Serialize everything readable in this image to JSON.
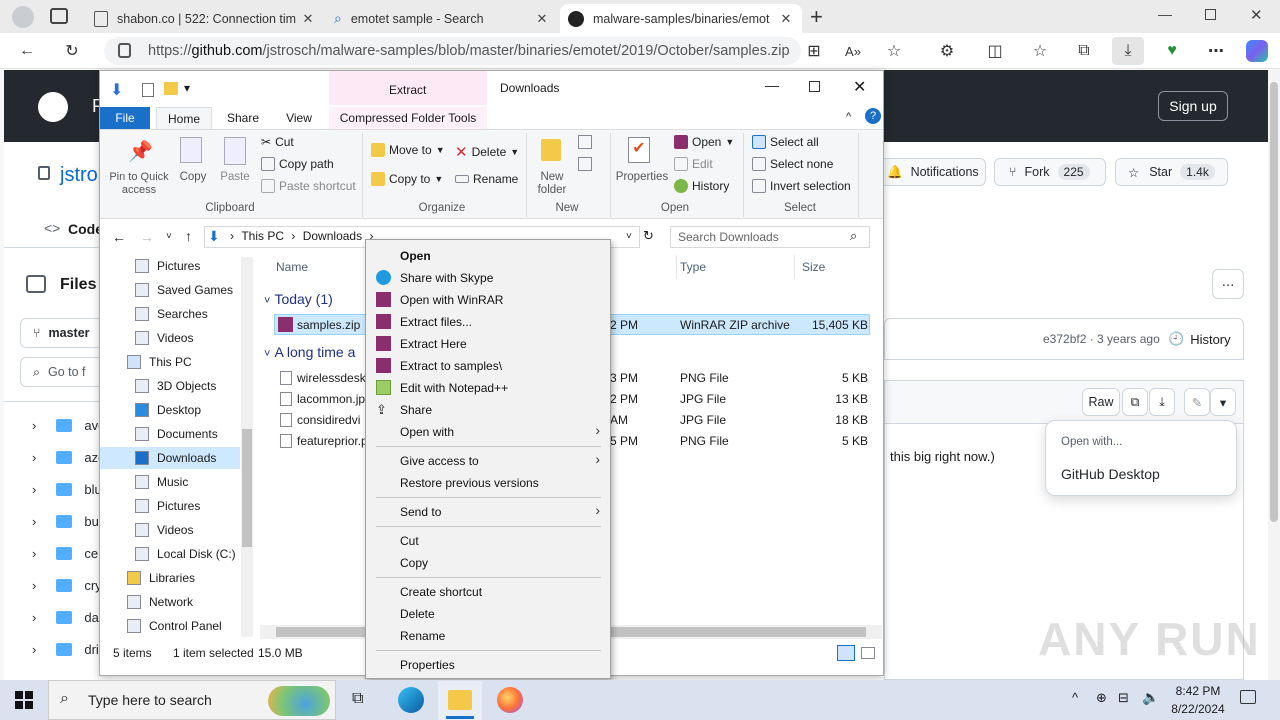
{
  "browser": {
    "tabs": [
      {
        "title": "shabon.co | 522: Connection tim",
        "active": false
      },
      {
        "title": "emotet sample - Search",
        "active": false
      },
      {
        "title": "malware-samples/binaries/emot",
        "active": true
      }
    ],
    "new_tab": "+",
    "url_prefix": "https://",
    "url_host": "github.com",
    "url_path": "/jstrosch/malware-samples/blob/master/binaries/emotet/2019/October/samples.zip"
  },
  "github": {
    "sign_up": "Sign up",
    "repo_owner": "jstro",
    "code_tab": "Code",
    "notifications": "Notifications",
    "fork_label": "Fork",
    "fork_count": "225",
    "star_label": "Star",
    "star_count": "1.4k",
    "files_title": "Files",
    "branch": "master",
    "goto_placeholder": "Go to f",
    "commit_info": "e372bf2 · 3 years ago",
    "history": "History",
    "raw": "Raw",
    "too_big": "this big right now.)",
    "tree": [
      "ave",
      "azo",
      "blue",
      "bue",
      "cerb",
      "cryp",
      "dan",
      "dric"
    ],
    "open_with": {
      "header": "Open with...",
      "item": "GitHub Desktop"
    },
    "header_extra_text": "o"
  },
  "explorer": {
    "title": "Downloads",
    "contextual_tab": "Extract",
    "ribbon_tabs": {
      "file": "File",
      "home": "Home",
      "share": "Share",
      "view": "View",
      "compressed": "Compressed Folder Tools"
    },
    "clipboard": {
      "pin": "Pin to Quick access",
      "copy": "Copy",
      "paste": "Paste",
      "cut": "Cut",
      "copy_path": "Copy path",
      "paste_shortcut": "Paste shortcut",
      "label": "Clipboard"
    },
    "organize": {
      "move_to": "Move to",
      "copy_to": "Copy to",
      "delete": "Delete",
      "rename": "Rename",
      "label": "Organize"
    },
    "new": {
      "new_folder": "New folder",
      "label": "New"
    },
    "open": {
      "properties": "Properties",
      "open": "Open",
      "edit": "Edit",
      "history": "History",
      "label": "Open"
    },
    "select": {
      "all": "Select all",
      "none": "Select none",
      "invert": "Invert selection",
      "label": "Select"
    },
    "breadcrumb": [
      "This PC",
      "Downloads"
    ],
    "search_placeholder": "Search Downloads",
    "nav_items": [
      "Pictures",
      "Saved Games",
      "Searches",
      "Videos",
      "This PC",
      "3D Objects",
      "Desktop",
      "Documents",
      "Downloads",
      "Music",
      "Pictures",
      "Videos",
      "Local Disk (C:)",
      "Libraries",
      "Network",
      "Control Panel"
    ],
    "columns": {
      "name": "Name",
      "type": "Type",
      "size": "Size"
    },
    "groups": {
      "today": "Today (1)",
      "long_ago": "A long time a"
    },
    "files": [
      {
        "name": "samples.zip",
        "time": "2 PM",
        "type": "WinRAR ZIP archive",
        "size": "15,405 KB"
      },
      {
        "name": "wirelessdeskt",
        "time": "3 PM",
        "type": "PNG File",
        "size": "5 KB"
      },
      {
        "name": "lacommon.jp",
        "time": "2 PM",
        "type": "JPG File",
        "size": "13 KB"
      },
      {
        "name": "considiredvi",
        "time": "AM",
        "type": "JPG File",
        "size": "18 KB"
      },
      {
        "name": "featureprior.p",
        "time": "5 PM",
        "type": "PNG File",
        "size": "5 KB"
      }
    ],
    "status": {
      "items": "5 items",
      "selected": "1 item selected",
      "size": "15.0 MB"
    }
  },
  "context_menu": {
    "open": "Open",
    "skype": "Share with Skype",
    "winrar": "Open with WinRAR",
    "extract_files": "Extract files...",
    "extract_here": "Extract Here",
    "extract_to": "Extract to samples\\",
    "notepad": "Edit with Notepad++",
    "share": "Share",
    "open_with": "Open with",
    "give_access": "Give access to",
    "restore": "Restore previous versions",
    "send_to": "Send to",
    "cut": "Cut",
    "copy": "Copy",
    "create_shortcut": "Create shortcut",
    "delete": "Delete",
    "rename": "Rename",
    "properties": "Properties"
  },
  "taskbar": {
    "search_placeholder": "Type here to search",
    "time": "8:42 PM",
    "date": "8/22/2024"
  },
  "watermark": "ANY RUN"
}
